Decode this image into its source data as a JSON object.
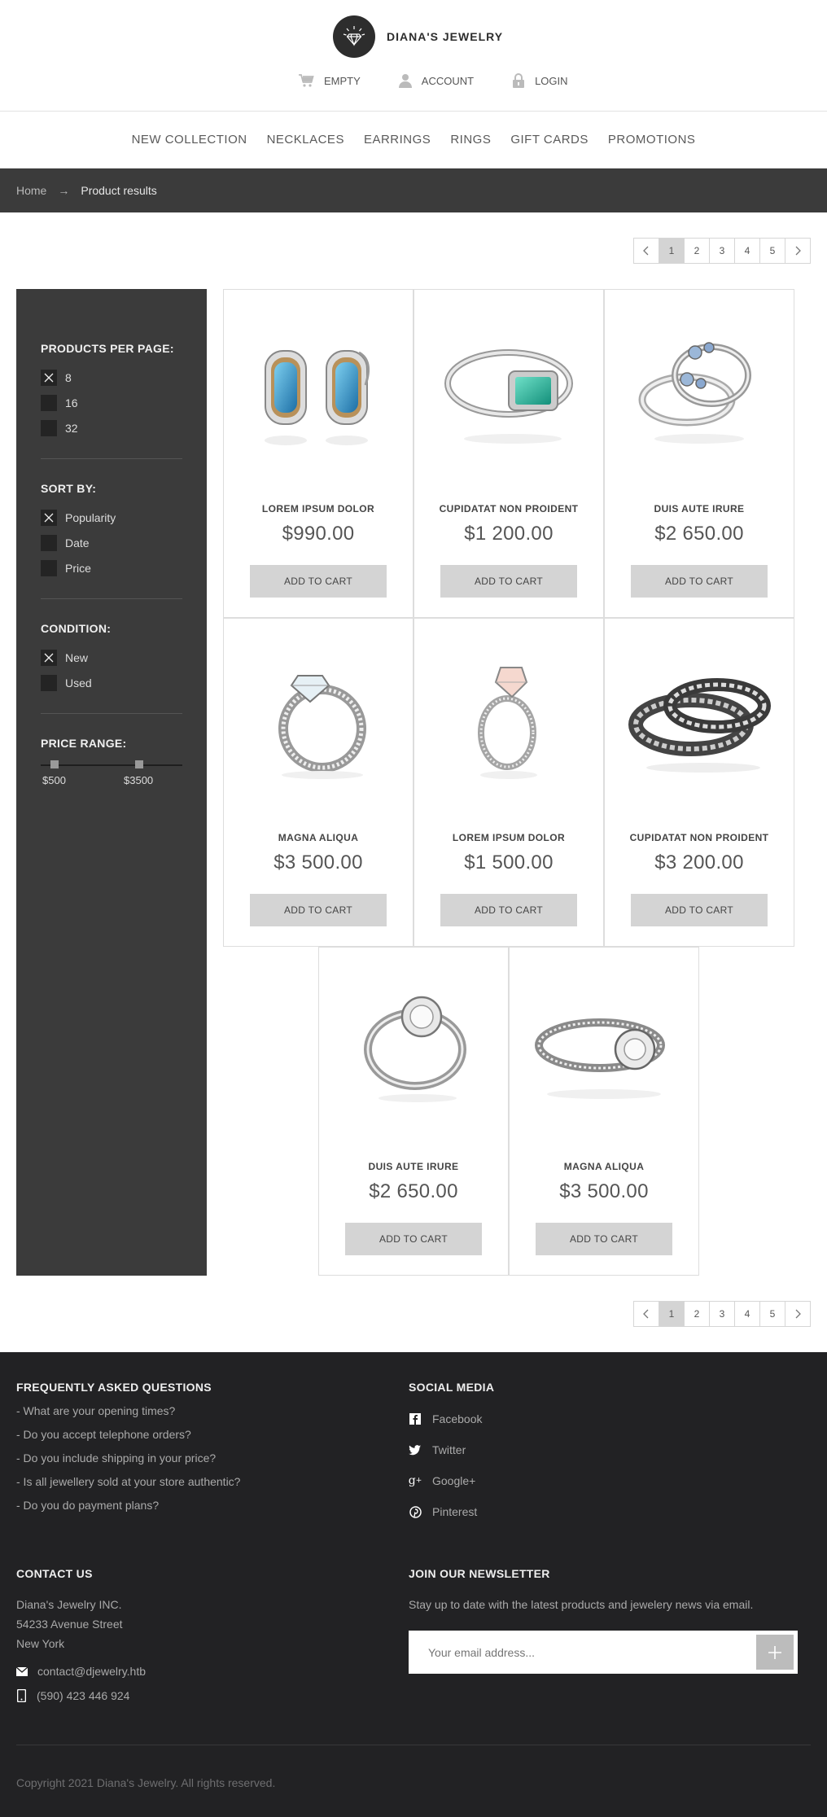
{
  "brand": {
    "name": "DIANA'S JEWELRY"
  },
  "top_links": [
    {
      "label": "EMPTY",
      "icon": "cart-icon"
    },
    {
      "label": "ACCOUNT",
      "icon": "user-icon"
    },
    {
      "label": "LOGIN",
      "icon": "lock-icon"
    }
  ],
  "nav": [
    "NEW COLLECTION",
    "NECKLACES",
    "EARRINGS",
    "RINGS",
    "GIFT CARDS",
    "PROMOTIONS"
  ],
  "breadcrumb": {
    "home": "Home",
    "arrow": "→",
    "current": "Product results"
  },
  "pagination": {
    "prev": "‹",
    "pages": [
      "1",
      "2",
      "3",
      "4",
      "5"
    ],
    "next": "›",
    "active_page": "1"
  },
  "filters": {
    "per_page": {
      "title": "PRODUCTS PER PAGE:",
      "options": [
        "8",
        "16",
        "32"
      ],
      "checked": "8"
    },
    "sort_by": {
      "title": "SORT BY:",
      "options": [
        "Popularity",
        "Date",
        "Price"
      ],
      "checked": "Popularity"
    },
    "condition": {
      "title": "CONDITION:",
      "options": [
        "New",
        "Used"
      ],
      "checked": "New"
    },
    "price_range": {
      "title": "PRICE RANGE:",
      "min_label": "$500",
      "max_label": "$3500",
      "min_value": 500,
      "max_value": 3500
    }
  },
  "products": [
    {
      "name": "LOREM IPSUM DOLOR",
      "price": "$990.00",
      "button": "ADD TO CART",
      "image": "earrings-image"
    },
    {
      "name": "CUPIDATAT NON PROIDENT",
      "price": "$1 200.00",
      "button": "ADD TO CART",
      "image": "emerald-ring-image"
    },
    {
      "name": "DUIS AUTE IRURE",
      "price": "$2 650.00",
      "button": "ADD TO CART",
      "image": "sapphire-rings-image"
    },
    {
      "name": "MAGNA ALIQUA",
      "price": "$3 500.00",
      "button": "ADD TO CART",
      "image": "diamond-ring-image"
    },
    {
      "name": "LOREM IPSUM DOLOR",
      "price": "$1 500.00",
      "button": "ADD TO CART",
      "image": "pink-diamond-ring-image"
    },
    {
      "name": "CUPIDATAT NON PROIDENT",
      "price": "$3 200.00",
      "button": "ADD TO CART",
      "image": "band-rings-image"
    },
    {
      "name": "DUIS AUTE IRURE",
      "price": "$2 650.00",
      "button": "ADD TO CART",
      "image": "halo-ring-image"
    },
    {
      "name": "MAGNA ALIQUA",
      "price": "$3 500.00",
      "button": "ADD TO CART",
      "image": "solitaire-ring-image"
    }
  ],
  "footer": {
    "faq": {
      "title": "FREQUENTLY ASKED QUESTIONS",
      "items": [
        "- What are your opening times?",
        "- Do you accept telephone orders?",
        "- Do you include shipping in your price?",
        "- Is all jewellery sold at your store authentic?",
        "- Do you do payment plans?"
      ]
    },
    "social": {
      "title": "SOCIAL MEDIA",
      "items": [
        {
          "label": "Facebook",
          "icon": "facebook-icon"
        },
        {
          "label": "Twitter",
          "icon": "twitter-icon"
        },
        {
          "label": "Google+",
          "icon": "google-plus-icon"
        },
        {
          "label": "Pinterest",
          "icon": "pinterest-icon"
        }
      ]
    },
    "contact": {
      "title": "CONTACT US",
      "address_lines": [
        "Diana's Jewelry INC.",
        "54233 Avenue Street",
        "New York"
      ],
      "email": "contact@djewelry.htb",
      "phone": "(590) 423 446 924"
    },
    "newsletter": {
      "title": "JOIN OUR NEWSLETTER",
      "text": "Stay up to date with the latest products and jewelery news via email.",
      "placeholder": "Your email address..."
    },
    "copyright": "Copyright 2021 Diana's Jewelry. All rights reserved."
  }
}
